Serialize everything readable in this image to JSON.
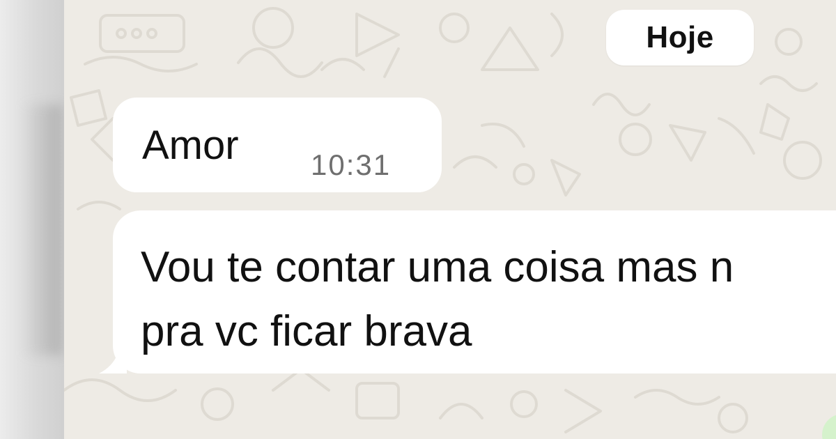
{
  "chat": {
    "date_separator": "Hoje",
    "messages": [
      {
        "direction": "incoming",
        "lines": [
          "Amor"
        ],
        "time": "10:31"
      },
      {
        "direction": "incoming",
        "lines": [
          "Vou te contar uma coisa mas n",
          "pra vc ficar brava"
        ]
      }
    ]
  },
  "colors": {
    "chat_background": "#eeebe5",
    "bubble_incoming": "#ffffff",
    "bubble_outgoing": "#d5f2cc",
    "text": "#111111",
    "timestamp": "#6f6f6f"
  },
  "icons": [
    "chat-wallpaper-doodles"
  ]
}
